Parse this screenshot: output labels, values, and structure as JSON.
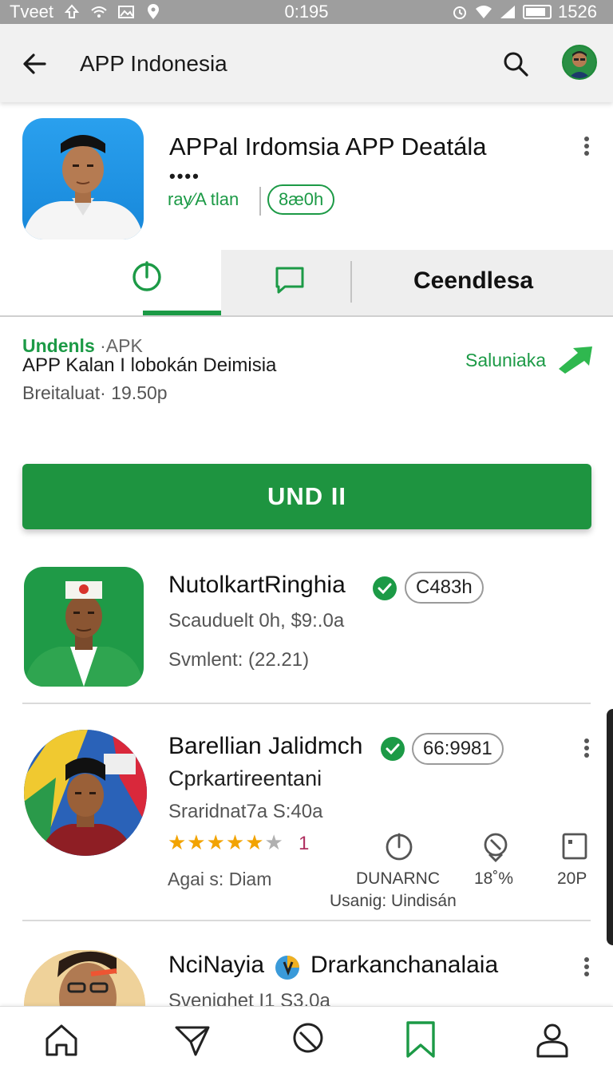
{
  "status_bar": {
    "left_text": "Tveet",
    "time": "0:195",
    "battery_text": "1526",
    "icons": [
      "upload-icon",
      "wifi-icon",
      "image-icon",
      "location-icon",
      "alarm-icon",
      "signal-icon",
      "battery-icon"
    ]
  },
  "app_bar": {
    "title": "APP Indonesia",
    "icons": [
      "back-arrow-icon",
      "search-icon",
      "avatar"
    ]
  },
  "app": {
    "name": "APPal Irdomsia APP  Deatála",
    "dots": "••••",
    "developer": "ray⁄A tlan",
    "badge": "8æ0h"
  },
  "tabs": [
    {
      "icon": "power-icon",
      "active": true
    },
    {
      "icon": "chat-icon",
      "active": false
    },
    {
      "label": "Ceendlesa",
      "active": false
    }
  ],
  "info": {
    "tag_highlight": "Undenls",
    "tag_rest": " ·APK",
    "title": "APP Kalan I lobokán Deimisia",
    "size": "Breitaluat· 19.50p",
    "link": "Saluniaka"
  },
  "primary_button": "UND IΙ",
  "list": [
    {
      "title": "NutolkartRinghia",
      "badge": "C483h",
      "line1": "Scauduelt 0h, $9:.0a",
      "line2": "Svmlent: (22.21)"
    },
    {
      "title": "Barellian Jalidmch",
      "badge": "66:9981",
      "subtitle": "Cprkartireentani",
      "line1": "Sraridnat7a S:40a",
      "rating": "★★★★★",
      "rating_off": "★",
      "rating_count": "1",
      "age": "Agai s: Diam",
      "stats": [
        {
          "icon": "power-icon",
          "label": "DUNARNC"
        },
        {
          "icon": "tag-icon",
          "label": "18˚%"
        },
        {
          "icon": "file-icon",
          "label": "20P"
        }
      ],
      "usage": "Usanig: Uindisán"
    },
    {
      "title_a": "NciNayia",
      "title_b": "Drarkanchanalaia",
      "line1": "Svenighet I1 S3.0a"
    }
  ],
  "bottom_nav": [
    "home-icon",
    "send-icon",
    "tag-icon",
    "bookmark-icon",
    "profile-icon"
  ],
  "colors": {
    "accent": "#1c9a46",
    "button": "#1e9440",
    "status_bar": "#9e9e9e",
    "app_bar": "#f1f1f1",
    "star": "#f2a300"
  }
}
